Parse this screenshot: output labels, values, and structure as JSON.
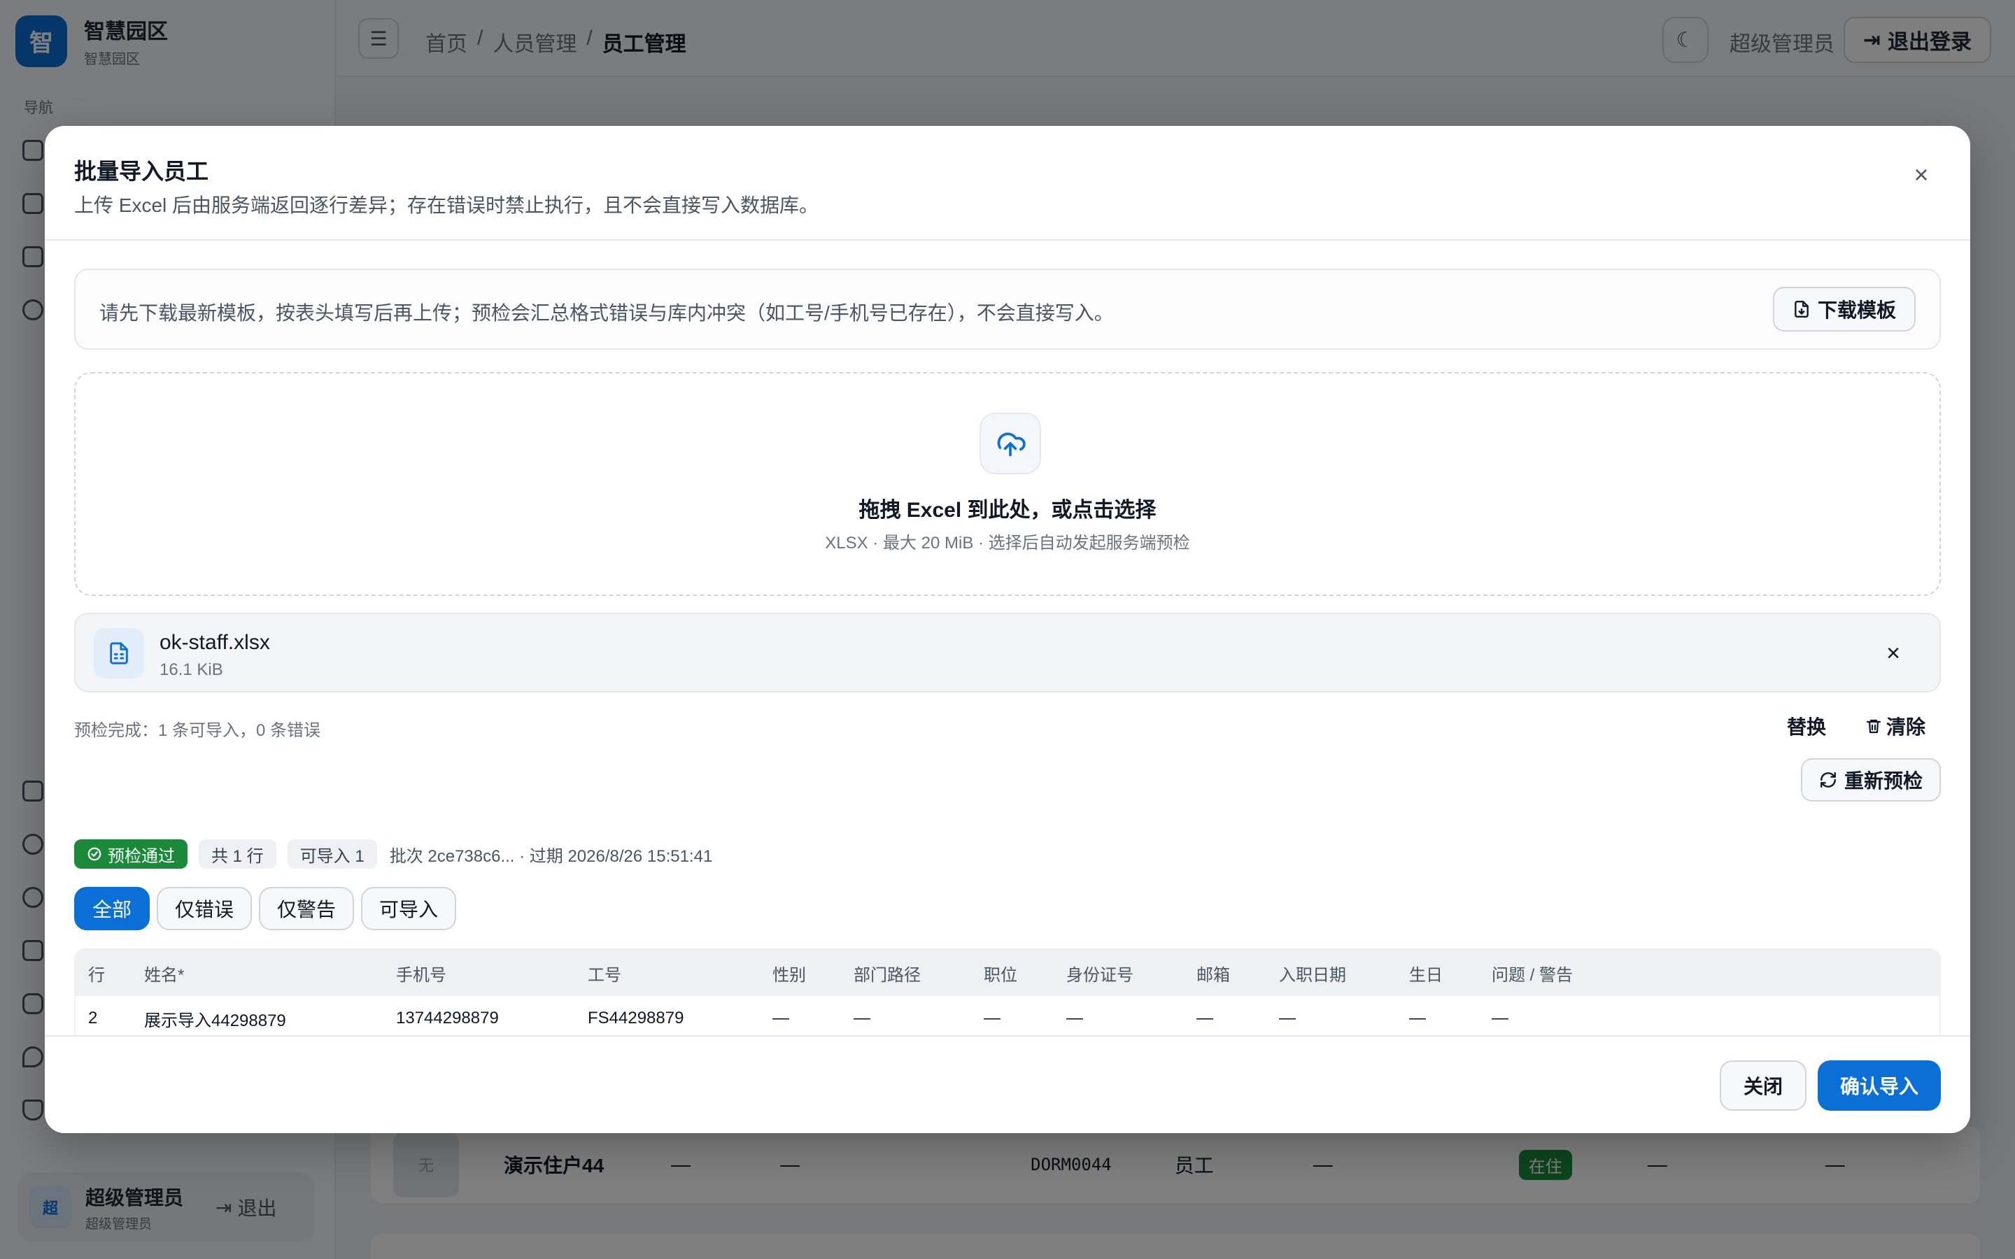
{
  "app": {
    "brand_logo_char": "智",
    "brand_title": "智慧园区",
    "brand_subtitle": "智慧园区",
    "nav_label": "导航",
    "sidebar_user": {
      "avatar": "超",
      "name": "超级管理员",
      "role": "超级管理员",
      "logout": "退出"
    },
    "breadcrumb": [
      "首页",
      "/",
      "人员管理",
      "/",
      "员工管理"
    ],
    "top_user": "超级管理员",
    "top_logout": "退出登录",
    "bg_row": {
      "avatar": "无",
      "name": "演示住户44",
      "c1": "—",
      "c2": "—",
      "code": "DORM0044",
      "type": "员工",
      "c3": "—",
      "status": "在住",
      "c4": "—",
      "c5": "—"
    }
  },
  "modal": {
    "title": "批量导入员工",
    "description": "上传 Excel 后由服务端返回逐行差异；存在错误时禁止执行，且不会直接写入数据库。",
    "notice": "请先下载最新模板，按表头填写后再上传；预检会汇总格式错误与库内冲突（如工号/手机号已存在），不会直接写入。",
    "download_template": "下载模板",
    "dropzone": {
      "title": "拖拽 Excel 到此处，或点击选择",
      "subtitle": "XLSX · 最大 20 MiB · 选择后自动发起服务端预检"
    },
    "file": {
      "name": "ok-staff.xlsx",
      "size": "16.1 KiB"
    },
    "precheck_summary": "预检完成：1 条可导入，0 条错误",
    "replace": "替换",
    "clear": "清除",
    "recheck": "重新预检",
    "status": {
      "pass": "预检通过",
      "total": "共 1 行",
      "importable": "可导入 1",
      "batch": "批次 2ce738c6... · 过期 2026/8/26 15:51:41"
    },
    "filters": [
      "全部",
      "仅错误",
      "仅警告",
      "可导入"
    ],
    "table": {
      "headers": [
        "行",
        "姓名*",
        "手机号",
        "工号",
        "性别",
        "部门路径",
        "职位",
        "身份证号",
        "邮箱",
        "入职日期",
        "生日",
        "问题 / 警告"
      ],
      "rows": [
        [
          "2",
          "展示导入44298879",
          "13744298879",
          "FS44298879",
          "—",
          "—",
          "—",
          "—",
          "—",
          "—",
          "—",
          "—"
        ]
      ]
    },
    "footer": {
      "close": "关闭",
      "confirm": "确认导入"
    }
  },
  "colors": {
    "primary": "#0a6fd6",
    "success": "#1a8a3a",
    "overlay": "rgba(0,0,0,0.5)"
  }
}
